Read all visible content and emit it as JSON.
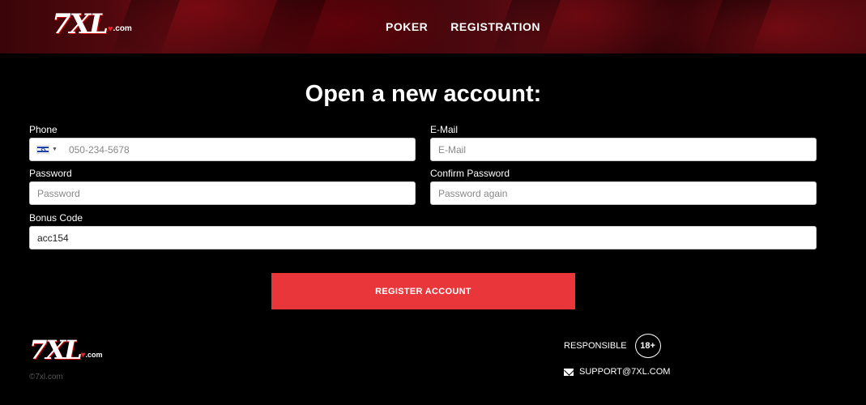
{
  "header": {
    "logo_text": "7XL",
    "logo_suffix": ".com",
    "nav": [
      {
        "label": "POKER"
      },
      {
        "label": "REGISTRATION"
      }
    ]
  },
  "form": {
    "title": "Open a new account:",
    "phone": {
      "label": "Phone",
      "placeholder": "050-234-5678",
      "country_flag": "flag-israel"
    },
    "email": {
      "label": "E-Mail",
      "placeholder": "E-Mail"
    },
    "password": {
      "label": "Password",
      "placeholder": "Password"
    },
    "confirm_password": {
      "label": "Confirm Password",
      "placeholder": "Password again"
    },
    "bonus_code": {
      "label": "Bonus Code",
      "value": "acc154"
    },
    "submit_label": "REGISTER ACCOUNT"
  },
  "footer": {
    "logo_text": "7XL",
    "logo_suffix": ".com",
    "copyright": "©7xl.com",
    "responsible_label": "RESPONSIBLE",
    "age_badge": "18+",
    "support_email": "SUPPORT@7XL.COM"
  },
  "colors": {
    "accent": "#e8363b",
    "background": "#000000",
    "header_red": "#5a0a10"
  }
}
